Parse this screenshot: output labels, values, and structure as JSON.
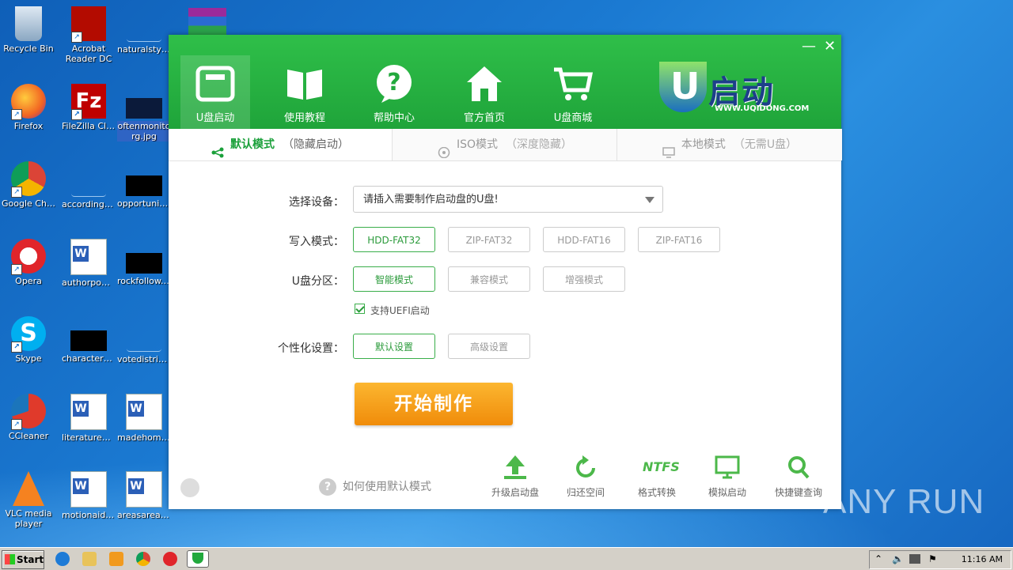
{
  "desktop": {
    "icons": [
      {
        "label": "Recycle Bin"
      },
      {
        "label": "Acrobat Reader DC"
      },
      {
        "label": "naturalstyl..."
      },
      {
        "label": "Firefox"
      },
      {
        "label": "FileZilla Client"
      },
      {
        "label": "oftenmonitorg.jpg"
      },
      {
        "label": "Google Chrome"
      },
      {
        "label": "accordingm..."
      },
      {
        "label": "opportunit..."
      },
      {
        "label": "Opera"
      },
      {
        "label": "authorpow..."
      },
      {
        "label": "rockfollow.jpg"
      },
      {
        "label": "Skype"
      },
      {
        "label": "charactersa..."
      },
      {
        "label": "votedistribu..."
      },
      {
        "label": "CCleaner"
      },
      {
        "label": "literaturepl..."
      },
      {
        "label": "madehomes..."
      },
      {
        "label": "VLC media player"
      },
      {
        "label": "motionaid.rtf"
      },
      {
        "label": "areasarea.rtf"
      }
    ]
  },
  "app": {
    "nav": [
      {
        "label": "U盘启动"
      },
      {
        "label": "使用教程"
      },
      {
        "label": "帮助中心"
      },
      {
        "label": "官方首页"
      },
      {
        "label": "U盘商城"
      }
    ],
    "logo": {
      "text": "启动",
      "letter": "U",
      "url": "WWW.UQIDONG.COM"
    },
    "tabs": [
      {
        "label": "默认模式",
        "sub": "（隐藏启动）"
      },
      {
        "label": "ISO模式",
        "sub": "（深度隐藏）"
      },
      {
        "label": "本地模式",
        "sub": "（无需U盘）"
      }
    ],
    "form": {
      "device_label": "选择设备：",
      "device_value": "请插入需要制作启动盘的U盘!",
      "write_label": "写入模式：",
      "write_options": [
        "HDD-FAT32",
        "ZIP-FAT32",
        "HDD-FAT16",
        "ZIP-FAT16"
      ],
      "partition_label": "U盘分区：",
      "partition_options": [
        "智能模式",
        "兼容模式",
        "增强模式"
      ],
      "uefi_label": "支持UEFI启动",
      "personal_label": "个性化设置：",
      "personal_options": [
        "默认设置",
        "高级设置"
      ],
      "start_button": "开始制作"
    },
    "help_text": "如何使用默认模式",
    "tools": [
      {
        "label": "升级启动盘"
      },
      {
        "label": "归还空间"
      },
      {
        "label": "格式转换",
        "icon_text": "NTFS"
      },
      {
        "label": "模拟启动"
      },
      {
        "label": "快捷键查询"
      }
    ],
    "colors": {
      "header": "#22a93d",
      "accent": "#2a9a3a",
      "start": "#f5a020"
    }
  },
  "taskbar": {
    "start_label": "Start",
    "clock": "11:16 AM"
  },
  "watermark": "ANY RUN"
}
